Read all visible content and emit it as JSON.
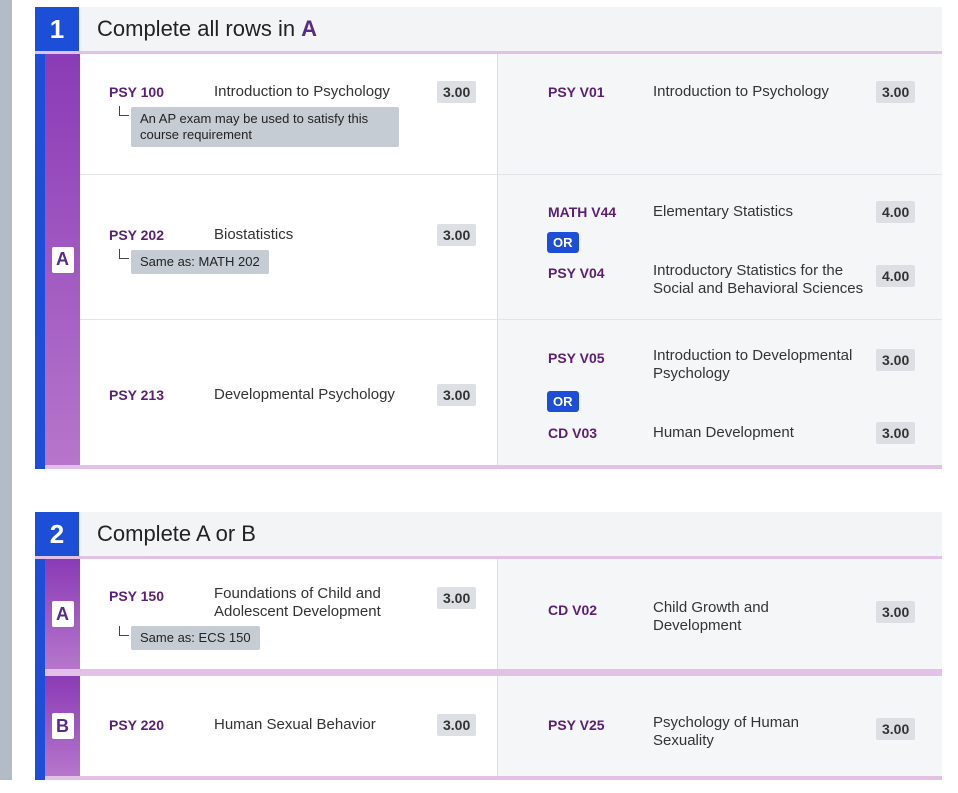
{
  "groups": [
    {
      "number": "1",
      "title": "Complete all rows in",
      "title_bold": "A",
      "sections": [
        {
          "label": "A",
          "rows": [
            {
              "receiving": {
                "code": "PSY 100",
                "title": "Introduction to Psychology",
                "units": "3.00",
                "note": "An AP exam may be used to satisfy this course requirement"
              },
              "sending": [
                {
                  "code": "PSY V01",
                  "title": "Introduction to Psychology",
                  "units": "3.00"
                }
              ]
            },
            {
              "receiving": {
                "code": "PSY 202",
                "title": "Biostatistics",
                "units": "3.00",
                "note": "Same as: MATH 202"
              },
              "sending": [
                {
                  "code": "MATH V44",
                  "title": "Elementary Statistics",
                  "units": "4.00"
                },
                {
                  "code": "PSY V04",
                  "title": "Introductory Statistics for the Social and Behavioral Sciences",
                  "units": "4.00"
                }
              ],
              "or_label": "OR"
            },
            {
              "receiving": {
                "code": "PSY 213",
                "title": "Developmental Psychology",
                "units": "3.00"
              },
              "sending": [
                {
                  "code": "PSY V05",
                  "title": "Introduction to Developmental Psychology",
                  "units": "3.00"
                },
                {
                  "code": "CD V03",
                  "title": "Human Development",
                  "units": "3.00"
                }
              ],
              "or_label": "OR"
            }
          ]
        }
      ]
    },
    {
      "number": "2",
      "title": "Complete A or B",
      "sections": [
        {
          "label": "A",
          "rows": [
            {
              "receiving": {
                "code": "PSY 150",
                "title": "Foundations of Child and Adolescent Development",
                "units": "3.00",
                "note": "Same as: ECS 150"
              },
              "sending": [
                {
                  "code": "CD V02",
                  "title": "Child Growth and Development",
                  "units": "3.00"
                }
              ]
            }
          ]
        },
        {
          "label": "B",
          "rows": [
            {
              "receiving": {
                "code": "PSY 220",
                "title": "Human Sexual Behavior",
                "units": "3.00"
              },
              "sending": [
                {
                  "code": "PSY V25",
                  "title": "Psychology of Human Sexuality",
                  "units": "3.00"
                }
              ]
            }
          ]
        }
      ]
    }
  ],
  "icons": {
    "arrow": "arrow-left-icon",
    "elbow": "tree-elbow-icon"
  },
  "colors": {
    "accent": "#1d4ed8",
    "course_code": "#5b1f73",
    "section_purple": "#8a3bb6"
  }
}
